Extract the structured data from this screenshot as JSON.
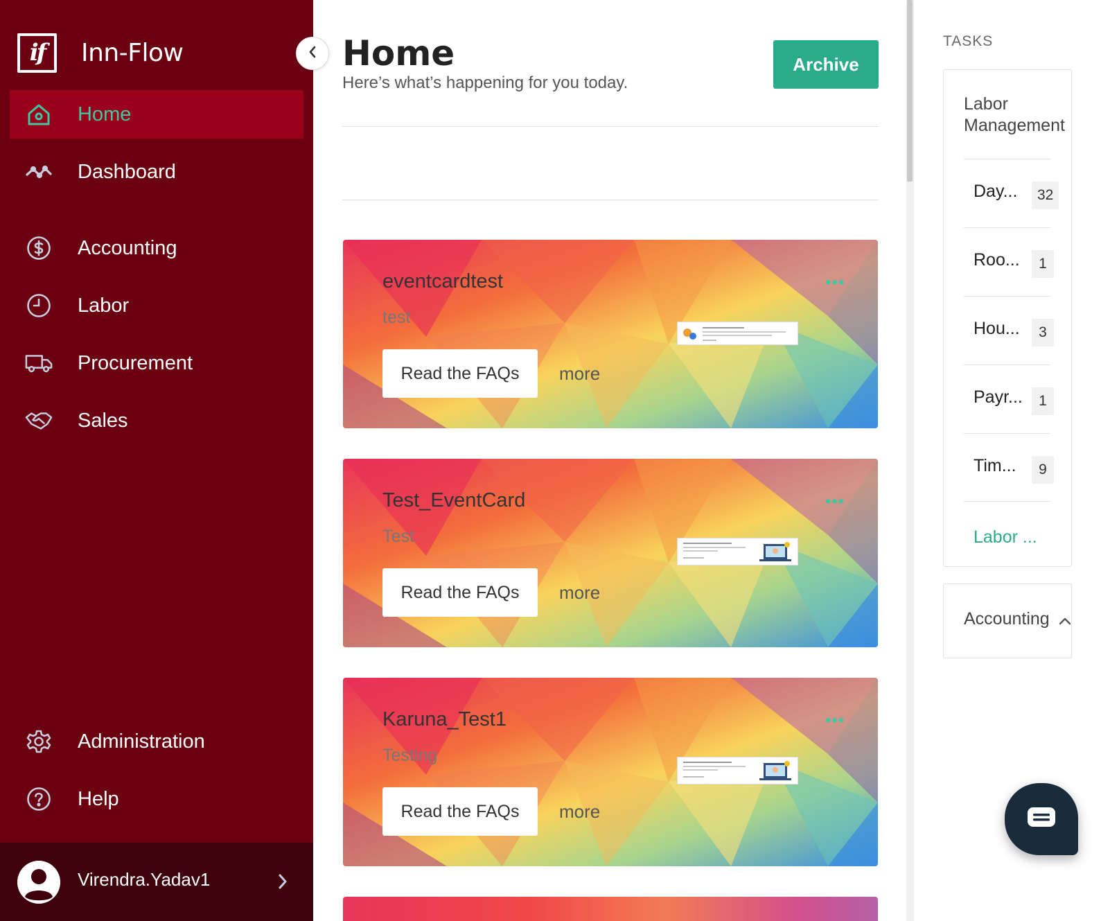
{
  "brand": {
    "logo_text": "if",
    "name": "Inn-Flow"
  },
  "nav": {
    "items": [
      {
        "label": "Home",
        "icon": "home-icon",
        "active": true
      },
      {
        "label": "Dashboard",
        "icon": "activity-icon"
      },
      {
        "label": "Accounting",
        "icon": "dollar-circle-icon"
      },
      {
        "label": "Labor",
        "icon": "clock-icon"
      },
      {
        "label": "Procurement",
        "icon": "truck-icon"
      },
      {
        "label": "Sales",
        "icon": "handshake-icon"
      }
    ],
    "bottom": [
      {
        "label": "Administration",
        "icon": "gear-icon"
      },
      {
        "label": "Help",
        "icon": "help-circle-icon"
      }
    ]
  },
  "user": {
    "name": "Virendra.Yadav1"
  },
  "header": {
    "title": "Home",
    "subtitle": "Here’s what’s happening for you today.",
    "archive_label": "Archive"
  },
  "cards": [
    {
      "title": "eventcardtest",
      "subtitle": "test",
      "button": "Read the FAQs",
      "more": "more",
      "menu": "•••"
    },
    {
      "title": "Test_EventCard",
      "subtitle": "Test",
      "button": "Read the FAQs",
      "more": "more",
      "menu": "•••"
    },
    {
      "title": "Karuna_Test1",
      "subtitle": "Testing",
      "button": "Read the FAQs",
      "more": "more",
      "menu": "•••"
    }
  ],
  "tasks": {
    "title": "TASKS",
    "group": "Labor Management",
    "items": [
      {
        "name": "Day...",
        "count": "32"
      },
      {
        "name": "Roo...",
        "count": "1"
      },
      {
        "name": "Hou...",
        "count": "3"
      },
      {
        "name": "Payr...",
        "count": "1"
      },
      {
        "name": "Tim...",
        "count": "9"
      }
    ],
    "more_link": "Labor ...",
    "accounting_label": "Accounting"
  },
  "colors": {
    "sidebar": "#6b0011",
    "active": "#9a0019",
    "accent": "#2aab8c",
    "user_bar": "#3e000a"
  }
}
